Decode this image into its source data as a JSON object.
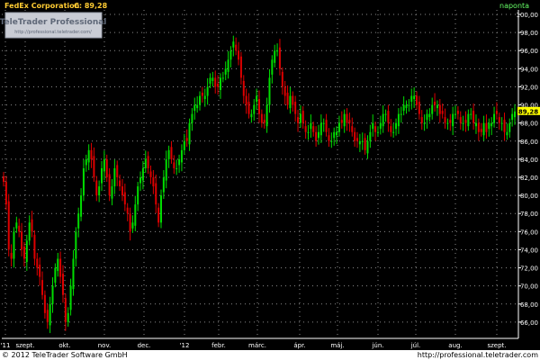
{
  "header": {
    "instrument": "FedEx Corporation",
    "close_label": "C: 89,28",
    "period": "naponta"
  },
  "watermark": {
    "brand": "TeleTrader Professional",
    "url": "http://professional.teletrader.com/"
  },
  "footer": {
    "copyright": "© 2012 TeleTrader Software GmbH",
    "url": "http://professional.teletrader.com"
  },
  "last_price_label": "89,28",
  "colors": {
    "background": "#000000",
    "up": "#00dd00",
    "down": "#dd0000",
    "grid": "#8a8a8a",
    "axis_text": "#ffffff",
    "title_text": "#ffcc33",
    "last_price_bg": "#ffff00"
  },
  "chart_data": {
    "type": "candlestick",
    "y_ticks": [
      "66,00",
      "68,00",
      "70,00",
      "72,00",
      "74,00",
      "76,00",
      "78,00",
      "80,00",
      "82,00",
      "84,00",
      "86,00",
      "88,00",
      "90,00",
      "92,00",
      "94,00",
      "96,00",
      "98,00",
      "100,00"
    ],
    "ylim": [
      64.2,
      100.5
    ],
    "x_ticks": [
      "'11",
      "szept.",
      "okt.",
      "nov.",
      "dec.",
      "'12",
      "febr.",
      "márc.",
      "ápr.",
      "máj.",
      "jún.",
      "júl.",
      "aug.",
      "szept."
    ],
    "xlabel": "",
    "ylabel": "",
    "grid": true,
    "close_series": [
      81.5,
      79,
      74,
      73,
      76,
      77,
      76,
      74,
      73,
      75,
      77,
      76,
      73,
      72,
      71,
      69,
      67,
      66,
      68,
      70,
      72,
      73,
      71,
      69,
      66,
      67,
      70,
      73,
      76,
      78,
      80,
      83,
      84,
      85,
      84,
      82,
      80,
      81,
      83,
      84,
      82,
      80,
      81,
      83,
      82,
      81,
      80,
      79,
      78,
      76,
      77,
      79,
      81,
      82,
      83,
      84,
      83,
      82,
      81,
      79,
      77,
      80,
      82,
      84,
      85,
      84,
      83,
      83,
      84,
      85,
      86,
      86,
      88,
      89,
      90,
      90,
      91,
      91,
      91,
      92,
      93,
      93,
      92,
      92,
      93,
      93,
      94,
      95,
      96,
      97,
      96,
      95,
      93,
      91,
      90,
      89,
      89,
      90,
      91,
      89,
      88,
      88,
      90,
      93,
      95,
      96,
      96,
      94,
      92,
      91,
      90,
      91,
      90,
      89,
      88,
      89,
      88,
      87,
      87,
      88,
      87,
      86,
      87,
      88,
      88,
      87,
      86,
      86,
      87,
      87,
      88,
      88,
      89,
      88,
      88,
      87,
      86,
      86,
      86,
      86,
      85,
      86,
      87,
      88,
      87,
      87,
      88,
      89,
      89,
      88,
      87,
      87,
      88,
      89,
      89,
      90,
      90,
      90,
      91,
      91,
      90,
      89,
      88,
      88,
      89,
      89,
      90,
      90,
      90,
      89,
      89,
      88,
      88,
      88,
      89,
      89,
      89,
      88,
      88,
      88,
      89,
      89,
      88,
      88,
      87,
      87,
      88,
      87,
      88,
      88,
      89,
      89,
      88,
      88,
      87,
      87,
      88,
      89,
      89.28
    ]
  }
}
